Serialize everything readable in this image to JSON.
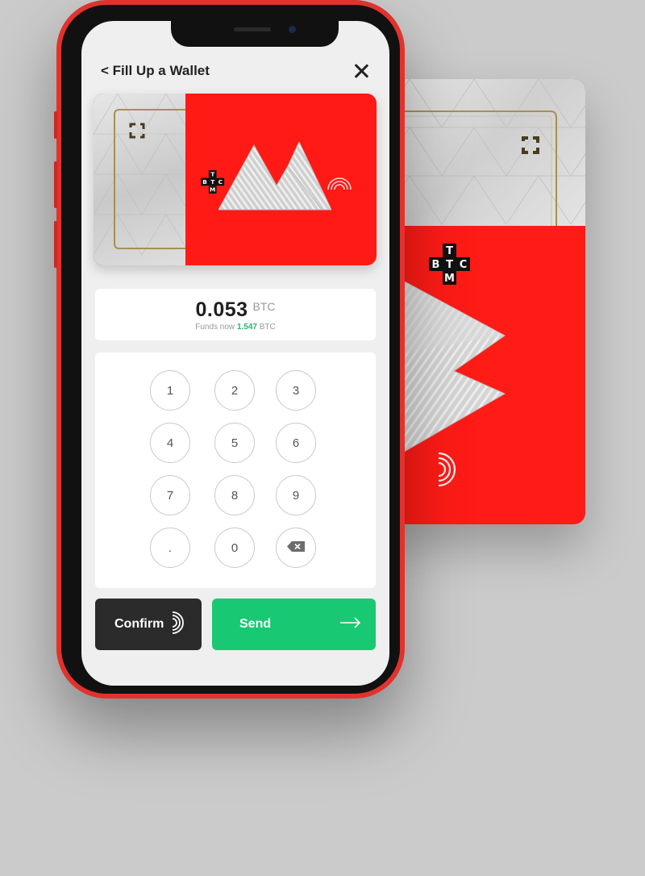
{
  "header": {
    "back_label": "< Fill Up a Wallet",
    "close_icon": "close-icon"
  },
  "card": {
    "brand_letters": [
      "T",
      "B",
      "T",
      "C",
      "M"
    ]
  },
  "amount": {
    "value": "0.053",
    "unit": "BTC",
    "funds_prefix": "Funds now",
    "funds_value": "1.547",
    "funds_unit": "BTC"
  },
  "keypad": {
    "keys": [
      "1",
      "2",
      "3",
      "4",
      "5",
      "6",
      "7",
      "8",
      "9",
      ".",
      "0"
    ],
    "backspace_icon": "backspace-icon"
  },
  "actions": {
    "confirm_label": "Confirm",
    "send_label": "Send",
    "nfc_icon": "nfc-icon",
    "arrow_icon": "arrow-right-icon"
  },
  "colors": {
    "brand_red": "#ff1a15",
    "send_green": "#19c873",
    "confirm_dark": "#2b2b2c",
    "funds_green": "#22b86a"
  }
}
